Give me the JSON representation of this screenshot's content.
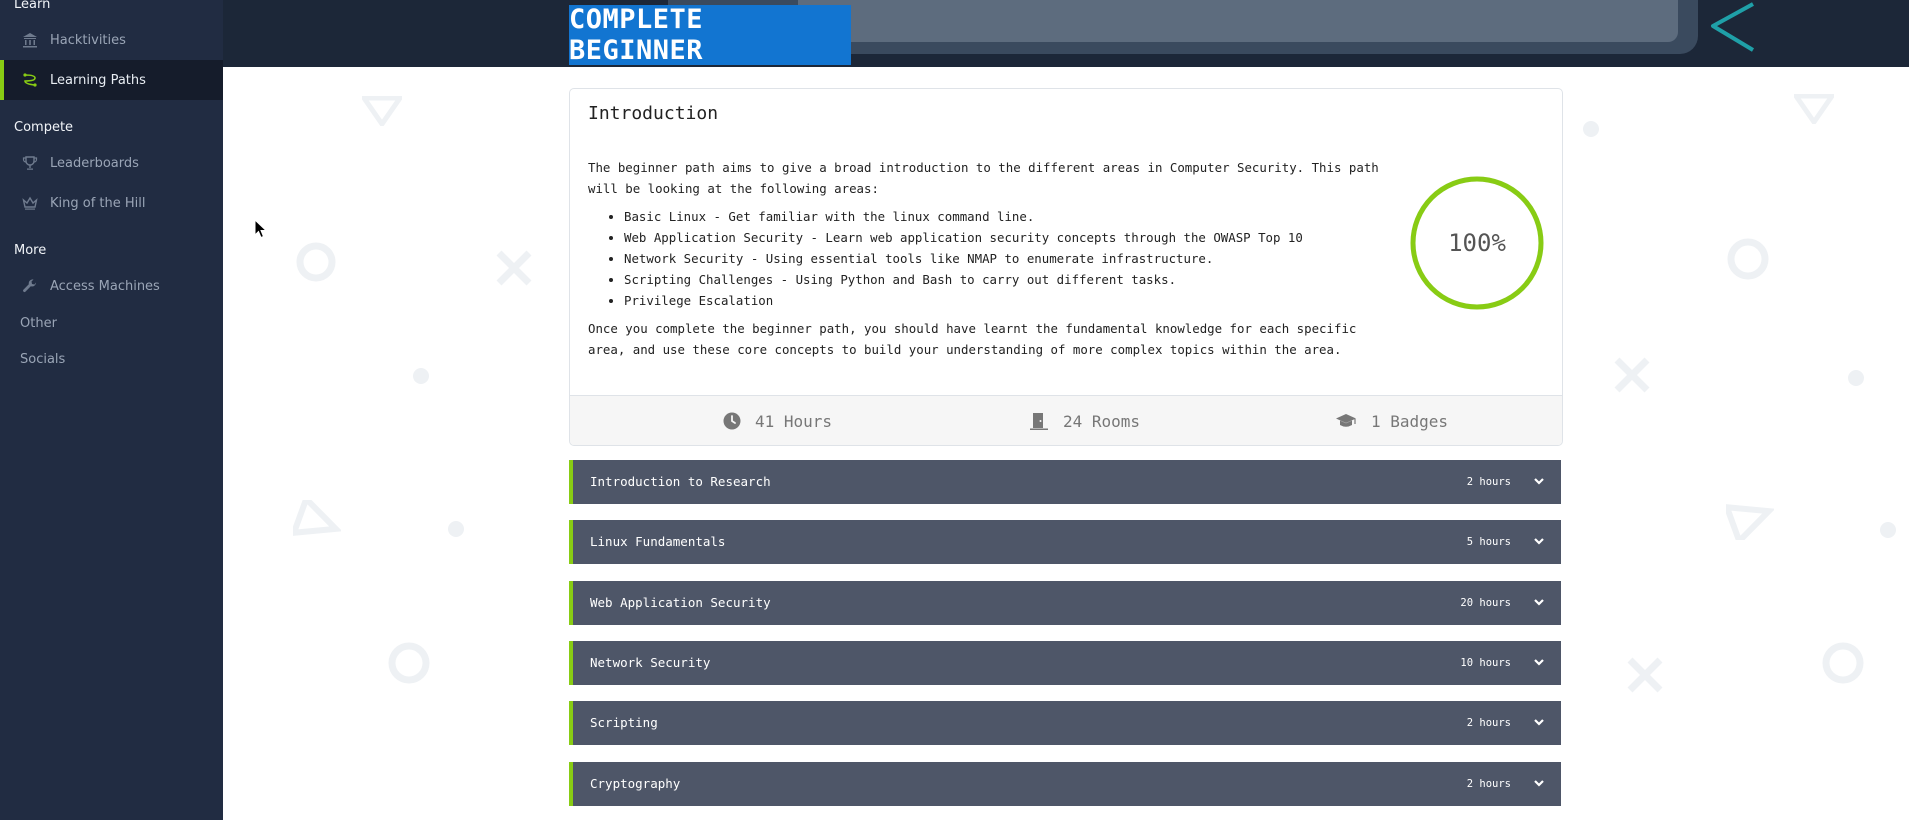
{
  "sidebar": {
    "learn_label": "Learn",
    "learn_items": [
      {
        "label": "Hacktivities",
        "icon": "bank-icon"
      },
      {
        "label": "Learning Paths",
        "icon": "path-icon",
        "active": true
      }
    ],
    "compete_label": "Compete",
    "compete_items": [
      {
        "label": "Leaderboards",
        "icon": "trophy-icon"
      },
      {
        "label": "King of the Hill",
        "icon": "crown-icon"
      }
    ],
    "more_label": "More",
    "more_items": [
      {
        "label": "Access Machines",
        "icon": "wrench-icon"
      },
      {
        "label": "Other"
      },
      {
        "label": "Socials"
      }
    ]
  },
  "banner": {
    "title": "COMPLETE BEGINNER"
  },
  "intro": {
    "heading": "Introduction",
    "paragraph1": "The beginner path aims to give a broad introduction to the different areas in Computer Security. This path will be looking at the following areas:",
    "bullets": [
      "Basic Linux - Get familiar with the linux command line.",
      "Web Application Security - Learn web application security concepts through the OWASP Top 10",
      "Network Security - Using essential tools like NMAP to enumerate infrastructure.",
      "Scripting Challenges - Using Python and Bash to carry out different tasks.",
      "Privilege Escalation"
    ],
    "paragraph2": "Once you complete the beginner path, you should have learnt the fundamental knowledge for each specific area, and use these core concepts to build your understanding of more complex topics within the area.",
    "progress_label": "100%",
    "progress_value": 1.0,
    "progress_color": "#88cc14"
  },
  "stats": {
    "hours": "41 Hours",
    "rooms": "24 Rooms",
    "badges": "1 Badges"
  },
  "modules": [
    {
      "title": "Introduction to Research",
      "hours": "2 hours"
    },
    {
      "title": "Linux Fundamentals",
      "hours": "5 hours"
    },
    {
      "title": "Web Application Security",
      "hours": "20 hours"
    },
    {
      "title": "Network Security",
      "hours": "10 hours"
    },
    {
      "title": "Scripting",
      "hours": "2 hours"
    },
    {
      "title": "Cryptography",
      "hours": "2 hours"
    }
  ],
  "colors": {
    "accent": "#88cc14",
    "sidebar_bg": "#212c42",
    "title_badge": "#1275d1",
    "module_bg": "#4e5668"
  }
}
